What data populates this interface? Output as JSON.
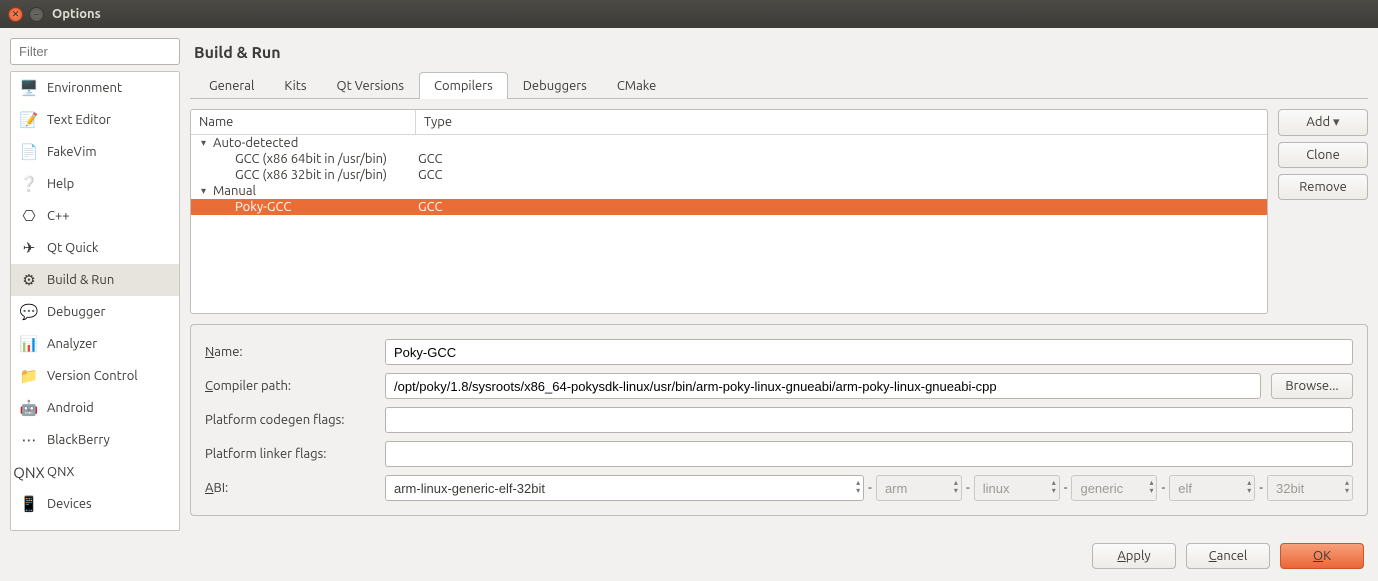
{
  "window": {
    "title": "Options"
  },
  "sidebar": {
    "filter_placeholder": "Filter",
    "items": [
      {
        "label": "Environment",
        "icon": "🖥️"
      },
      {
        "label": "Text Editor",
        "icon": "📝"
      },
      {
        "label": "FakeVim",
        "icon": "📄"
      },
      {
        "label": "Help",
        "icon": "❔"
      },
      {
        "label": "C++",
        "icon": "⎔"
      },
      {
        "label": "Qt Quick",
        "icon": "✈"
      },
      {
        "label": "Build & Run",
        "icon": "⚙"
      },
      {
        "label": "Debugger",
        "icon": "💬"
      },
      {
        "label": "Analyzer",
        "icon": "📊"
      },
      {
        "label": "Version Control",
        "icon": "📁"
      },
      {
        "label": "Android",
        "icon": "🤖"
      },
      {
        "label": "BlackBerry",
        "icon": "⋯"
      },
      {
        "label": "QNX",
        "icon": "QNX"
      },
      {
        "label": "Devices",
        "icon": "📱"
      }
    ],
    "selected": "Build & Run"
  },
  "content": {
    "heading": "Build & Run",
    "tabs": [
      "General",
      "Kits",
      "Qt Versions",
      "Compilers",
      "Debuggers",
      "CMake"
    ],
    "active_tab": "Compilers",
    "columns": {
      "name": "Name",
      "type": "Type"
    },
    "tree": [
      {
        "group": "Auto-detected",
        "items": [
          {
            "name": "GCC (x86 64bit in /usr/bin)",
            "type": "GCC"
          },
          {
            "name": "GCC (x86 32bit in /usr/bin)",
            "type": "GCC"
          }
        ]
      },
      {
        "group": "Manual",
        "items": [
          {
            "name": "Poky-GCC",
            "type": "GCC",
            "selected": true
          }
        ]
      }
    ],
    "buttons": {
      "add": "Add",
      "clone": "Clone",
      "remove": "Remove"
    },
    "form": {
      "name_label": "Name:",
      "name_value": "Poky-GCC",
      "compiler_path_label": "Compiler path:",
      "compiler_path_value": "/opt/poky/1.8/sysroots/x86_64-pokysdk-linux/usr/bin/arm-poky-linux-gnueabi/arm-poky-linux-gnueabi-cpp",
      "browse": "Browse...",
      "codegen_label": "Platform codegen flags:",
      "codegen_value": "",
      "linker_label": "Platform linker flags:",
      "linker_value": "",
      "abi_label": "ABI:",
      "abi_combo": "arm-linux-generic-elf-32bit",
      "abi_parts": [
        "arm",
        "linux",
        "generic",
        "elf",
        "32bit"
      ]
    }
  },
  "footer": {
    "apply": "Apply",
    "cancel": "Cancel",
    "ok": "OK"
  }
}
